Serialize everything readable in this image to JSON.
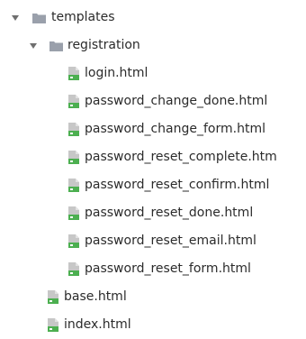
{
  "tree": {
    "root_folder": {
      "name": "templates",
      "icon": "folder-icon",
      "expanded": true
    },
    "sub_folder": {
      "name": "registration",
      "icon": "folder-icon",
      "expanded": true
    },
    "registration_files": [
      "login.html",
      "password_change_done.html",
      "password_change_form.html",
      "password_reset_complete.htm",
      "password_reset_confirm.html",
      "password_reset_done.html",
      "password_reset_email.html",
      "password_reset_form.html"
    ],
    "template_files": [
      "base.html",
      "index.html"
    ]
  },
  "colors": {
    "folder": "#9aa0ab",
    "file_icon_top": "#b9b9b9",
    "file_icon_badge": "#4caf50",
    "text": "#2b2b2b",
    "arrow": "#6f6f6f"
  }
}
